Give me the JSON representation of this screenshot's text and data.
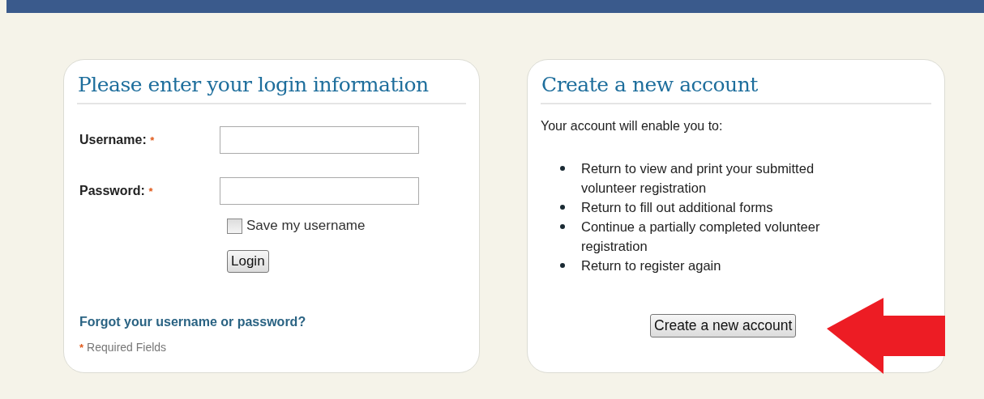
{
  "login": {
    "title": "Please enter your login information",
    "fields": [
      {
        "label": "Username:",
        "required_mark": "*"
      },
      {
        "label": "Password:",
        "required_mark": "*"
      }
    ],
    "save_username": {
      "label": "Save my username",
      "checked": false
    },
    "login_button": "Login",
    "forgot_link": "Forgot your username or password?",
    "required_note": {
      "mark": "*",
      "text": "Required Fields"
    }
  },
  "create": {
    "title": "Create a new account",
    "intro": "Your account will enable you to:",
    "benefits": [
      "Return to view and print your submitted volunteer registration",
      "Return to fill out additional forms",
      "Continue a partially completed volunteer registration",
      "Return to register again"
    ],
    "button": "Create a new account"
  }
}
